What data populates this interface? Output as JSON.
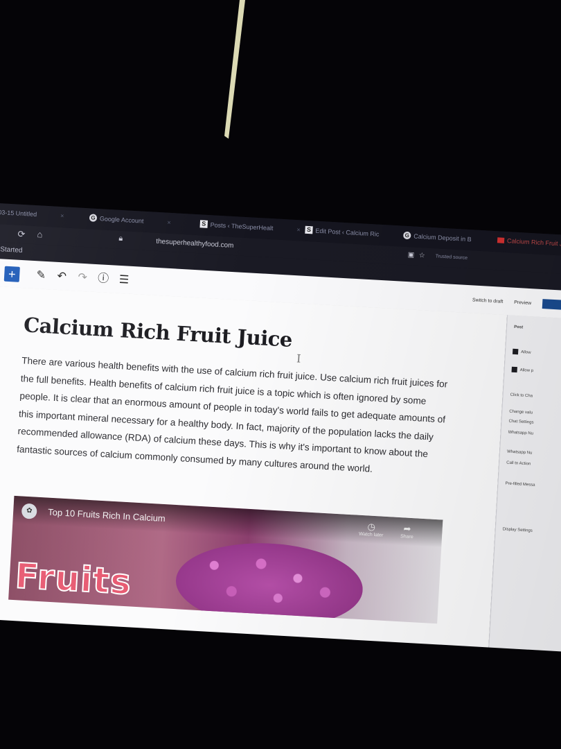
{
  "tabs": [
    {
      "label": "03-15 Untitled",
      "icon": "none"
    },
    {
      "label": "Google Account",
      "icon": "google-icon"
    },
    {
      "label": "Posts ‹ TheSuperHealt",
      "icon": "site-icon"
    },
    {
      "label": "Edit Post ‹ Calcium Ric",
      "icon": "site-icon"
    },
    {
      "label": "Calcium Deposit in B",
      "icon": "google-icon"
    },
    {
      "label": "Calcium Rich Fruit Jui",
      "icon": "youtube-icon"
    }
  ],
  "address_bar": {
    "url": "thesuperhealthyfood.com",
    "right_label": "Trusted source"
  },
  "bookmarks": {
    "started_label": "Started"
  },
  "editor": {
    "switch_to_draft": "Switch to draft",
    "preview": "Preview",
    "title": "Calcium Rich Fruit Juice",
    "body": "There are various health benefits with the use of calcium rich fruit juice. Use calcium rich fruit juices for the full benefits. Health benefits of calcium rich fruit juice is a topic which is often ignored by some people. It is clear that an enormous amount of people in today's world fails to get adequate amounts of this important mineral necessary for a healthy body. In fact, majority of the population lacks the daily recommended allowance (RDA) of calcium these days. This is why it's important to know about the fantastic sources of calcium commonly consumed by many cultures around the world."
  },
  "video": {
    "title": "Top 10 Fruits Rich In Calcium",
    "watch_later": "Watch later",
    "share": "Share",
    "thumbnail_text": "Fruits"
  },
  "sidebar": {
    "tab_label": "Post",
    "items": [
      "Allow",
      "Allow p",
      "Click to Cha",
      "Change valu",
      "Chat Settings",
      "Whatsapp Nu",
      "Whatsapp Nu",
      "Call to Action",
      "Pre-filled Messa",
      "Display Settings"
    ]
  },
  "colors": {
    "toolbar_accent": "#1e5bb8",
    "thumbnail_text": "#e85a72"
  }
}
